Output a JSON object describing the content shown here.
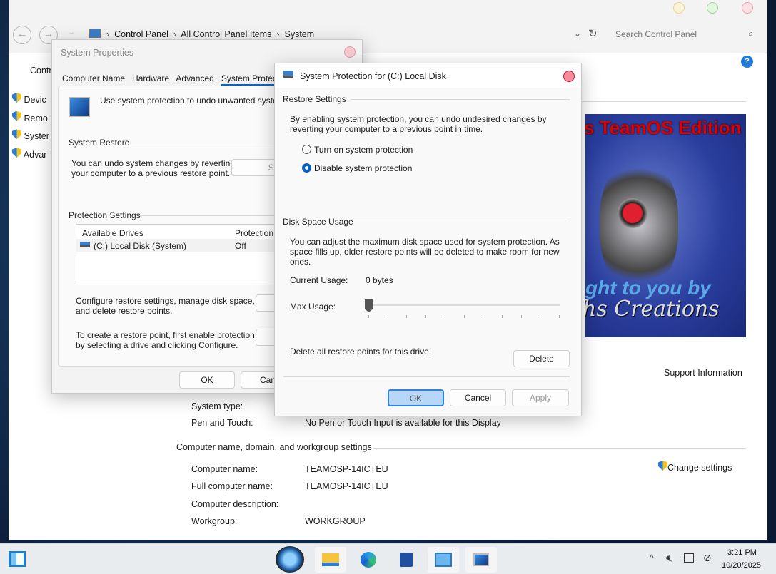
{
  "explorer": {
    "breadcrumb": [
      "Control Panel",
      "All Control Panel Items",
      "System"
    ],
    "search_placeholder": "Search Control Panel",
    "left_pane": {
      "title": "Contr",
      "items": [
        "Devic",
        "Remo",
        "Syster",
        "Advar"
      ]
    },
    "banner": {
      "line1": "s TeamOS Edition",
      "line2": "ght to you by",
      "line3": "hs Creations"
    },
    "support_information": "Support Information",
    "system_rows": [
      {
        "label": "System type:",
        "value": ""
      },
      {
        "label": "Pen and Touch:",
        "value": "No Pen or Touch Input is available for this Display"
      }
    ],
    "computer_section": {
      "title": "Computer name, domain, and workgroup settings",
      "change_settings": "Change settings",
      "rows": [
        {
          "label": "Computer name:",
          "value": "TEAMOSP-14ICTEU"
        },
        {
          "label": "Full computer name:",
          "value": "TEAMOSP-14ICTEU"
        },
        {
          "label": "Computer description:",
          "value": ""
        },
        {
          "label": "Workgroup:",
          "value": "WORKGROUP"
        }
      ]
    }
  },
  "system_properties": {
    "title": "System Properties",
    "tabs": [
      "Computer Name",
      "Hardware",
      "Advanced",
      "System Protection"
    ],
    "active_tab": 3,
    "intro": "Use system protection to undo unwanted system c",
    "system_restore": {
      "title": "System Restore",
      "text1": "You can undo system changes by reverting",
      "text2": "your computer to a previous restore point.",
      "button": "Syst"
    },
    "protection": {
      "title": "Protection Settings",
      "col_drives": "Available Drives",
      "col_protection": "Protection",
      "drives": [
        {
          "name": "(C:) Local Disk (System)",
          "protection": "Off"
        }
      ],
      "configure_text1": "Configure restore settings, manage disk space,",
      "configure_text2": "and delete restore points.",
      "configure_button": "C",
      "create_text1": "To create a restore point, first enable protection",
      "create_text2": "by selecting a drive and clicking Configure."
    },
    "ok": "OK",
    "cancel": "Canc"
  },
  "protection_dialog": {
    "title": "System Protection for (C:) Local Disk",
    "restore_settings": {
      "title": "Restore Settings",
      "text1": "By enabling system protection, you can undo undesired changes by",
      "text2": "reverting your computer to a previous point in time.",
      "options": [
        {
          "label": "Turn on system protection",
          "selected": false
        },
        {
          "label": "Disable system protection",
          "selected": true
        }
      ]
    },
    "disk_usage": {
      "title": "Disk Space Usage",
      "text1": "You can adjust the maximum disk space used for system protection. As",
      "text2": "space fills up, older restore points will be deleted to make room for new",
      "text3": "ones.",
      "current_label": "Current Usage:",
      "current_value": "0 bytes",
      "max_label": "Max Usage:",
      "max_percent": 0,
      "delete_text": "Delete all restore points for this drive.",
      "delete_button": "Delete"
    },
    "ok": "OK",
    "cancel": "Cancel",
    "apply": "Apply"
  },
  "taskbar": {
    "time": "3:21 PM",
    "date": "10/20/2025"
  }
}
